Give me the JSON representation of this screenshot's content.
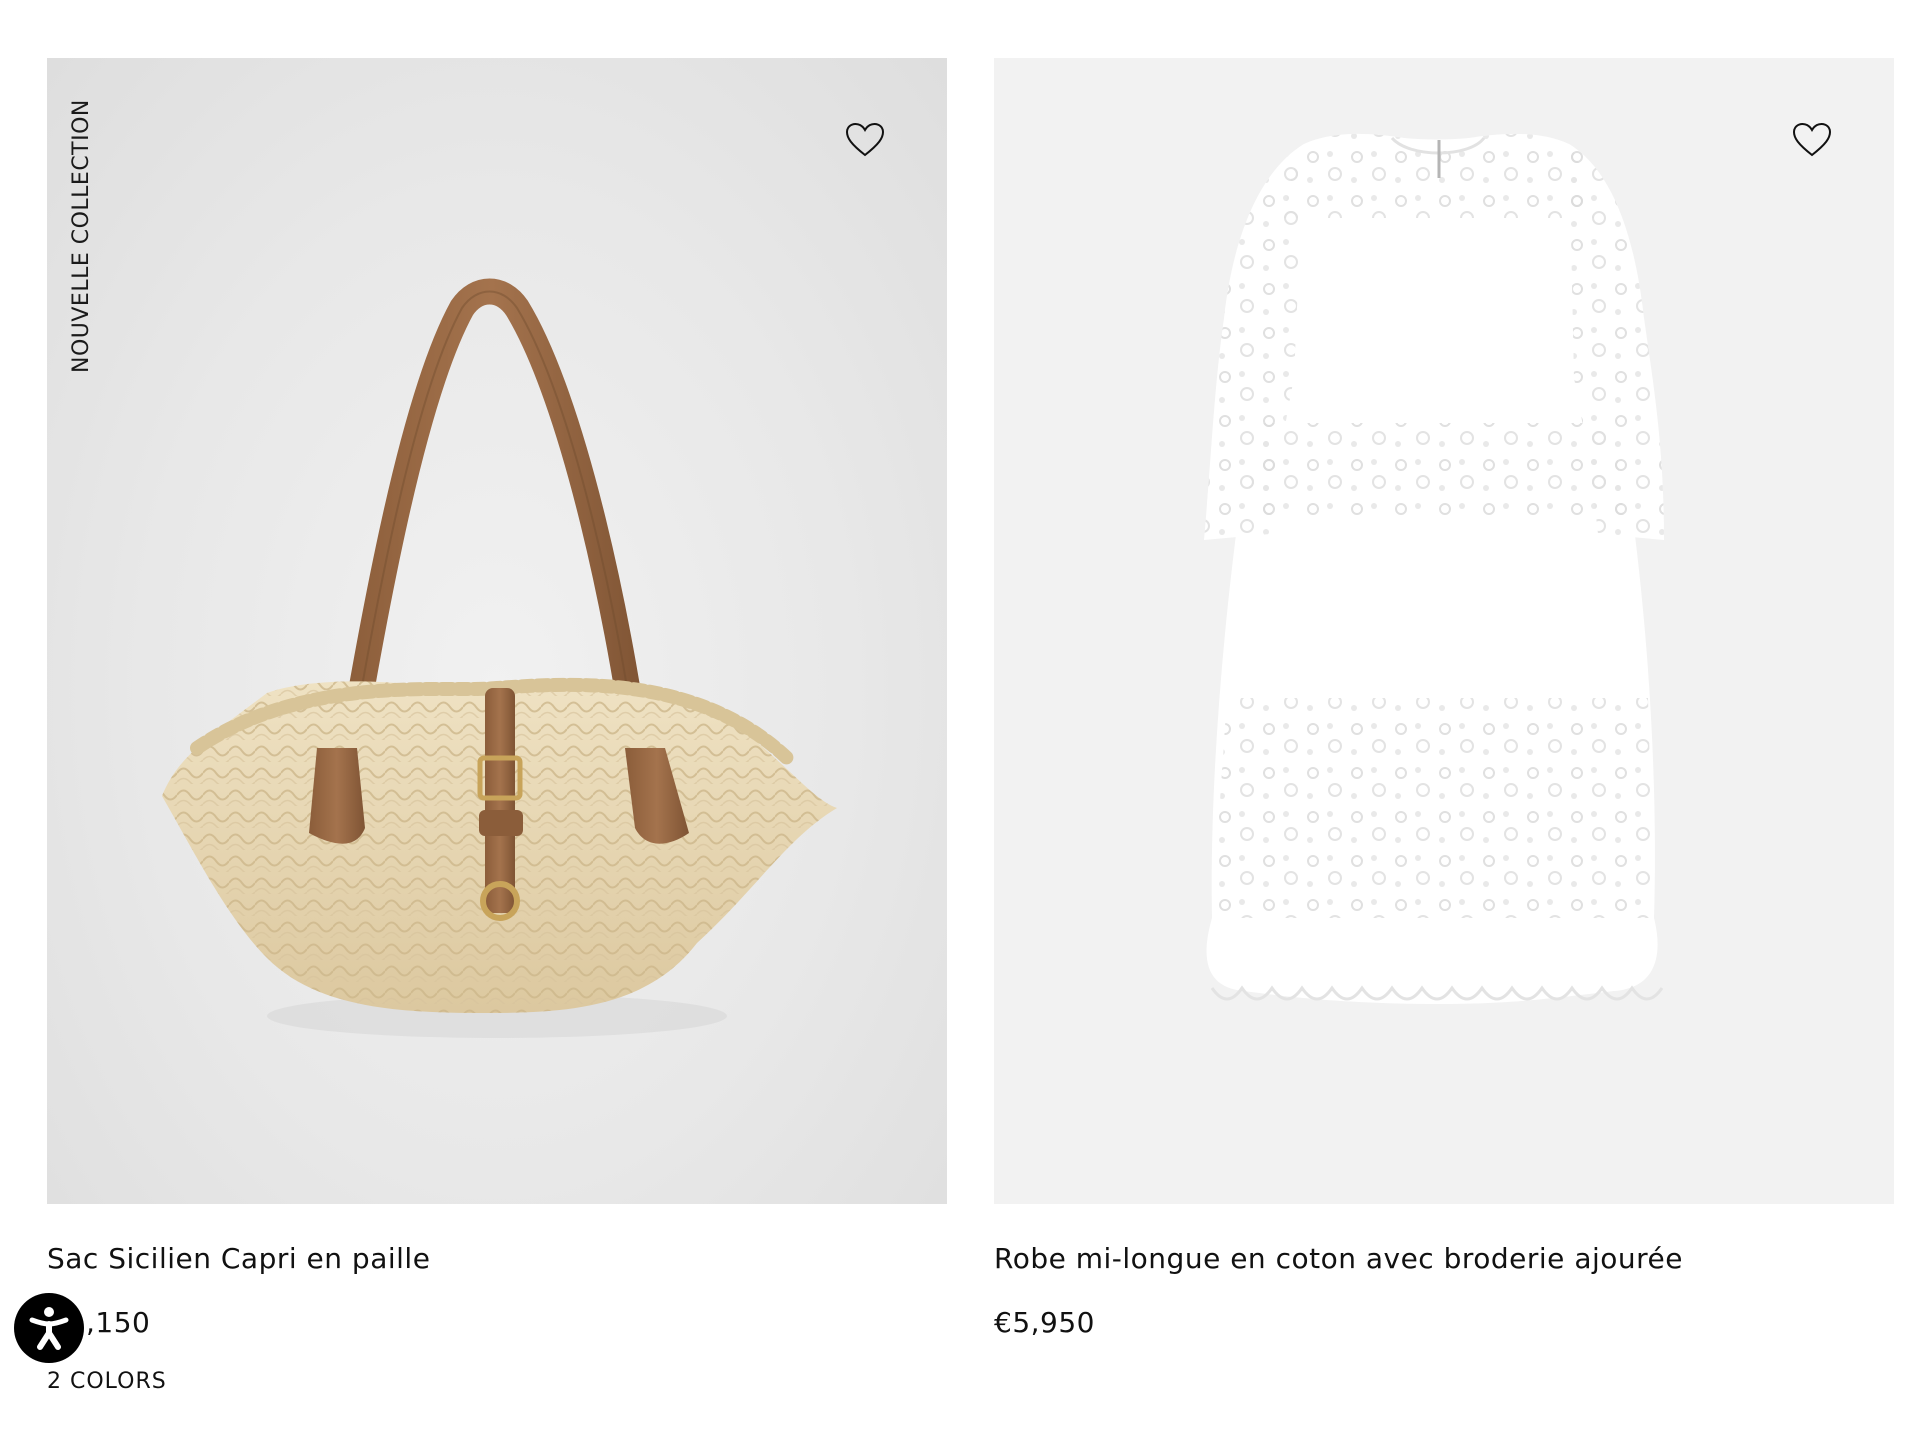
{
  "products": [
    {
      "badge": "NOUVELLE COLLECTION",
      "title": "Sac Sicilien Capri en paille",
      "price": ",150",
      "colors": "2 COLORS",
      "image_background": "#e9e9e9"
    },
    {
      "title": "Robe mi-longue en coton avec broderie ajourée",
      "price": "€5,950",
      "image_background": "#f2f2f2"
    }
  ],
  "icons": {
    "favorite": "heart-outline-icon",
    "accessibility": "accessibility-icon"
  },
  "colors": {
    "text": "#111111",
    "bag_leather": "#9a6a45",
    "bag_straw": "#e7d8b4",
    "accessibility_button": "#000000"
  }
}
